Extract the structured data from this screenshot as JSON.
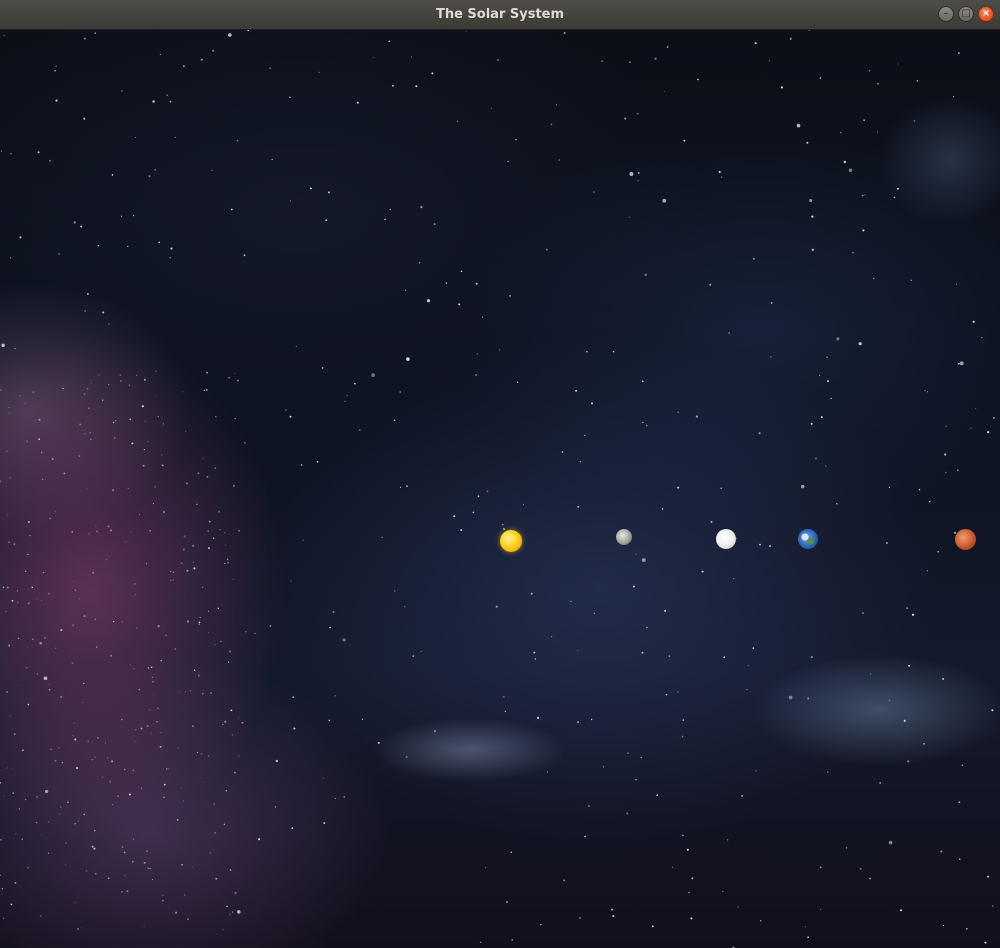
{
  "window": {
    "title": "The Solar System",
    "controls": {
      "minimize_glyph": "–",
      "maximize_glyph": "□",
      "close_glyph": "×"
    }
  },
  "scene": {
    "background": "starfield-nebula",
    "bodies": [
      {
        "name": "sun",
        "color": "#ffd21a"
      },
      {
        "name": "mercury",
        "color": "#a9a8a2"
      },
      {
        "name": "venus",
        "color": "#ececec"
      },
      {
        "name": "earth",
        "color": "#2a5fb0"
      },
      {
        "name": "mars",
        "color": "#c9562c"
      }
    ]
  }
}
